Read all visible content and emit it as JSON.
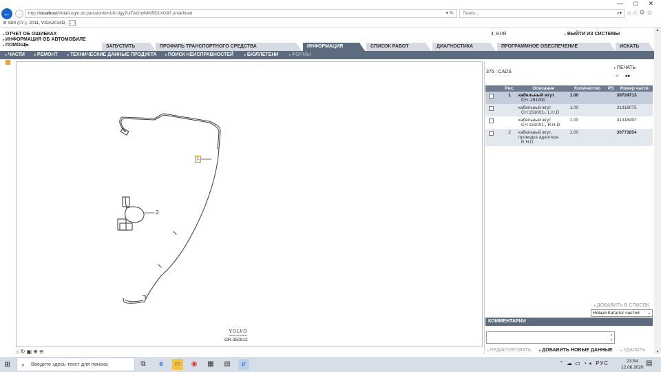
{
  "window": {
    "controls": [
      "—",
      "◻",
      "✕"
    ]
  },
  "browser": {
    "url_prefix": "http://",
    "url_host": "localhost",
    "url_path": "/Vida/Login.do;jsessionid=1iKUigy7uiTAGhdMt95D1XO97.undefined",
    "search_placeholder": "Поиск...",
    "tab_title": "S80 (07-), 2011, VIDA2014D, ..."
  },
  "header": {
    "menu_links": [
      "ОТЧЕТ ОБ ОШИБКАХ",
      "ИНФОРМАЦИЯ ОБ АВТОМОБИЛЕ",
      "ПОМОЩЬ"
    ],
    "currency": "4, EUR",
    "logout": "ВЫЙТИ ИЗ СИСТЕМЫ"
  },
  "main_tabs": [
    "ЗАПУСТИТЬ",
    "ПРОФИЛЬ ТРАНСПОРТНОГО СРЕДСТВА",
    "ИНФОРМАЦИЯ",
    "СПИСОК РАБОТ",
    "ДИАГНОСТИКА",
    "ПРОГРАММНОЕ ОБЕСПЕЧЕНИЕ",
    "ИСКАТЬ"
  ],
  "active_main_tab": "ИНФОРМАЦИЯ",
  "sub_nav": [
    "ЧАСТИ",
    "РЕМОНТ",
    "ТЕХНИЧЕСКИЕ ДАННЫЕ ПРОДУКТА",
    "ПОИСК НЕИСПРАВНОСТЕЙ",
    "БЮЛЛЕТЕНИ",
    "ФОРМЫ"
  ],
  "drawing": {
    "callouts": [
      "1",
      "2"
    ],
    "logo_text": "VOLVO",
    "logo_sub": "GENUINE PARTS",
    "code": "GR-350812"
  },
  "parts_panel": {
    "catalog_ref": "375 : CADS",
    "print": "ПЕЧАТЬ",
    "pager_prev": "‹‹",
    "pager_next": "▸▸",
    "columns": [
      "",
      "Рис.",
      "Описание",
      "Количество",
      "PS",
      "Номер части"
    ],
    "rows": [
      {
        "fig": "1",
        "desc": "кабельный жгут",
        "desc_sub": "CH -151000",
        "qty": "1.00",
        "ps": "",
        "part_no": "30724713",
        "style": "sel"
      },
      {
        "fig": "",
        "desc": "кабельный жгут",
        "desc_sub": "CH 151001-, L.H.D",
        "qty": "1.00",
        "ps": "",
        "part_no": "31318075",
        "style": "alt"
      },
      {
        "fig": "",
        "desc": "кабельный жгут",
        "desc_sub": "CH 151001-, R.H.D",
        "qty": "1.00",
        "ps": "",
        "part_no": "31318497",
        "style": "plain"
      },
      {
        "fig": "2",
        "desc": "кабельный жгут, проводка адаптера",
        "desc_sub": "R.H.D",
        "qty": "1.00",
        "ps": "",
        "part_no": "30773854",
        "style": "alt",
        "part_no_red": true
      }
    ],
    "add_to_list": "ДОБАВИТЬ В СПИСОК",
    "catalog_select": "Новый Каталог частей",
    "comments_header": "КОММЕНТАРИИ",
    "actions": {
      "edit": "РЕДАКТИРОВАТЬ",
      "add_new": "ДОБАВИТЬ НОВЫЕ ДАННЫЕ",
      "delete": "УДАЛИТЬ"
    }
  },
  "taskbar": {
    "search_placeholder": "Введите здесь текст для поиска",
    "language": "РУС",
    "time": "23:54",
    "date": "12.06.2020"
  },
  "colors": {
    "nav_bar": "#5d6b7e",
    "tab_inactive": "#d6dbe3",
    "table_header": "#6e7c8f",
    "selected_row": "#c3cddc",
    "alt_row": "#e3e8ef",
    "accent_orange": "#f3a23a",
    "part_red": "#e02020"
  }
}
